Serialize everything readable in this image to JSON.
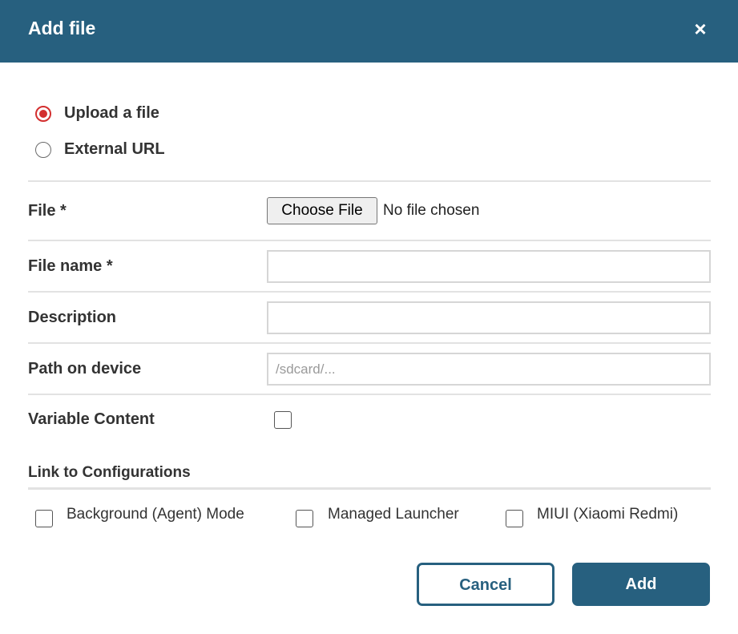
{
  "dialog": {
    "title": "Add file",
    "close_label": "×"
  },
  "source": {
    "options": [
      {
        "label": "Upload a file",
        "selected": true
      },
      {
        "label": "External URL",
        "selected": false
      }
    ]
  },
  "form": {
    "file_label": "File *",
    "choose_file_label": "Choose File",
    "no_file_text": "No file chosen",
    "file_name_label": "File name *",
    "file_name_value": "",
    "description_label": "Description",
    "description_value": "",
    "path_label": "Path on device",
    "path_value": "",
    "path_placeholder": "/sdcard/...",
    "variable_content_label": "Variable Content",
    "variable_content_checked": false
  },
  "configurations": {
    "title": "Link to Configurations",
    "items": [
      {
        "label": "Background (Agent) Mode",
        "checked": false
      },
      {
        "label": "Managed Launcher",
        "checked": false
      },
      {
        "label": "MIUI (Xiaomi Redmi)",
        "checked": false
      }
    ]
  },
  "actions": {
    "cancel_label": "Cancel",
    "add_label": "Add"
  },
  "colors": {
    "header_bg": "#27607f",
    "radio_selected": "#d32f2f",
    "divider": "#e2e2e2"
  }
}
